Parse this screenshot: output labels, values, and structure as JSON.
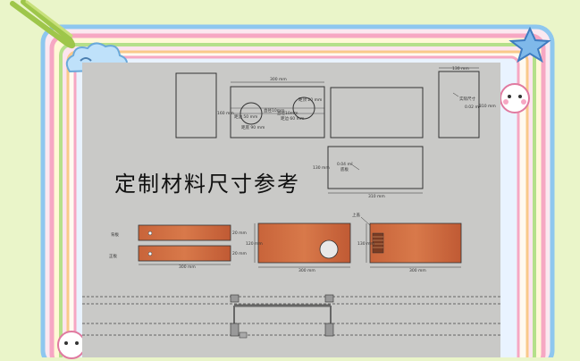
{
  "title": "定制材料尺寸参考",
  "panel_top": {
    "width_label": "300 mm",
    "height_label": "160 mm",
    "hole_left_label": "直径10mm",
    "hole_right_label": "直径10mm",
    "hole_left_offset": "距边 50 mm",
    "hole_right_offset": "距边 60 mm",
    "hole_bottom_note": "距底 90 mm",
    "hole_right_top": "距顶 20 mm"
  },
  "panel_side": {
    "width_label": "130 mm",
    "height_label": "310 mm",
    "note_label": "实际尺寸",
    "area_label": "0.02 m²"
  },
  "panel_bottom": {
    "width_label": "310 mm",
    "height_label": "130 mm",
    "area_label": "0.04 m²",
    "note_label": "底板"
  },
  "wood_boards": {
    "upper_label": "背板",
    "lower_label": "正板",
    "upper_dim": "20 mm",
    "lower_dim": "20 mm",
    "width_label": "300 mm"
  },
  "wood_front": {
    "height_label": "120 mm",
    "width_label": "300 mm"
  },
  "wood_right": {
    "top_label": "上盖",
    "height_label": "130 mm",
    "width_label": "300 mm"
  },
  "colors": {
    "page_bg": "#eaf5c9",
    "sheet": "#c9c9c7",
    "wood": "#c8643a",
    "frame_pink": "#f6a7c3",
    "frame_blue": "#8ec7ef"
  }
}
